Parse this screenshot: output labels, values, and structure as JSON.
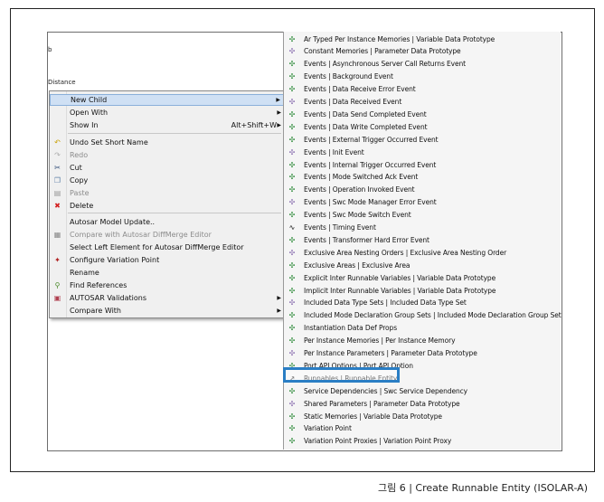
{
  "background_fragments": {
    "b": "b",
    "distance": "Distance"
  },
  "context_menu": {
    "items": [
      {
        "label": "New Child",
        "submenu": true,
        "icon": "none",
        "highlighted": true
      },
      {
        "label": "Open With",
        "submenu": true,
        "icon": "none"
      },
      {
        "label": "Show In",
        "shortcut": "Alt+Shift+W",
        "submenu": true,
        "icon": "none"
      },
      {
        "label": "Undo Set Short Name",
        "icon": "undo-icon"
      },
      {
        "label": "Redo",
        "icon": "redo-icon",
        "disabled": true
      },
      {
        "label": "Cut",
        "icon": "cut-icon"
      },
      {
        "label": "Copy",
        "icon": "copy-icon"
      },
      {
        "label": "Paste",
        "icon": "paste-icon",
        "disabled": true
      },
      {
        "label": "Delete",
        "icon": "delete-icon"
      },
      {
        "label": "Autosar Model Update..",
        "icon": "none"
      },
      {
        "label": "Compare with Autosar DiffMerge Editor",
        "icon": "compare-icon",
        "disabled": true
      },
      {
        "label": "Select Left Element for Autosar DiffMerge Editor",
        "icon": "none"
      },
      {
        "label": "Configure Variation Point",
        "icon": "variation-icon"
      },
      {
        "label": "Rename",
        "icon": "none"
      },
      {
        "label": "Find References",
        "icon": "find-icon"
      },
      {
        "label": "AUTOSAR Validations",
        "submenu": true,
        "icon": "validation-icon"
      },
      {
        "label": "Compare With",
        "submenu": true,
        "icon": "none"
      }
    ]
  },
  "submenu": {
    "items": [
      "Ar Typed Per Instance Memories | Variable Data Prototype",
      "Constant Memories | Parameter Data Prototype",
      "Events | Asynchronous Server Call Returns Event",
      "Events | Background Event",
      "Events | Data Receive Error Event",
      "Events | Data Received Event",
      "Events | Data Send Completed Event",
      "Events | Data Write Completed Event",
      "Events | External Trigger Occurred Event",
      "Events | Init Event",
      "Events | Internal Trigger Occurred Event",
      "Events | Mode Switched Ack Event",
      "Events | Operation Invoked Event",
      "Events | Swc Mode Manager Error Event",
      "Events | Swc Mode Switch Event",
      "Events | Timing Event",
      "Events | Transformer Hard Error Event",
      "Exclusive Area Nesting Orders | Exclusive Area Nesting Order",
      "Exclusive Areas | Exclusive Area",
      "Explicit Inter Runnable Variables | Variable Data Prototype",
      "Implicit Inter Runnable Variables | Variable Data Prototype",
      "Included Data Type Sets | Included Data Type Set",
      "Included Mode Declaration Group Sets | Included Mode Declaration Group Set",
      "Instantiation Data Def Props",
      "Per Instance Memories | Per Instance Memory",
      "Per Instance Parameters | Parameter Data Prototype",
      "Port API Options | Port API Option",
      "Runnables | Runnable Entity",
      "Service Dependencies | Swc Service Dependency",
      "Shared Parameters | Parameter Data Prototype",
      "Static Memories | Variable Data Prototype",
      "Variation Point",
      "Variation Point Proxies | Variation Point Proxy"
    ],
    "highlighted_item": "Runnables | Runnable Entity",
    "highlight_color": "#2a7ec4",
    "icon_color": "#2e8b3a"
  },
  "caption": "그림 6 | Create Runnable Entity (ISOLAR-A)"
}
